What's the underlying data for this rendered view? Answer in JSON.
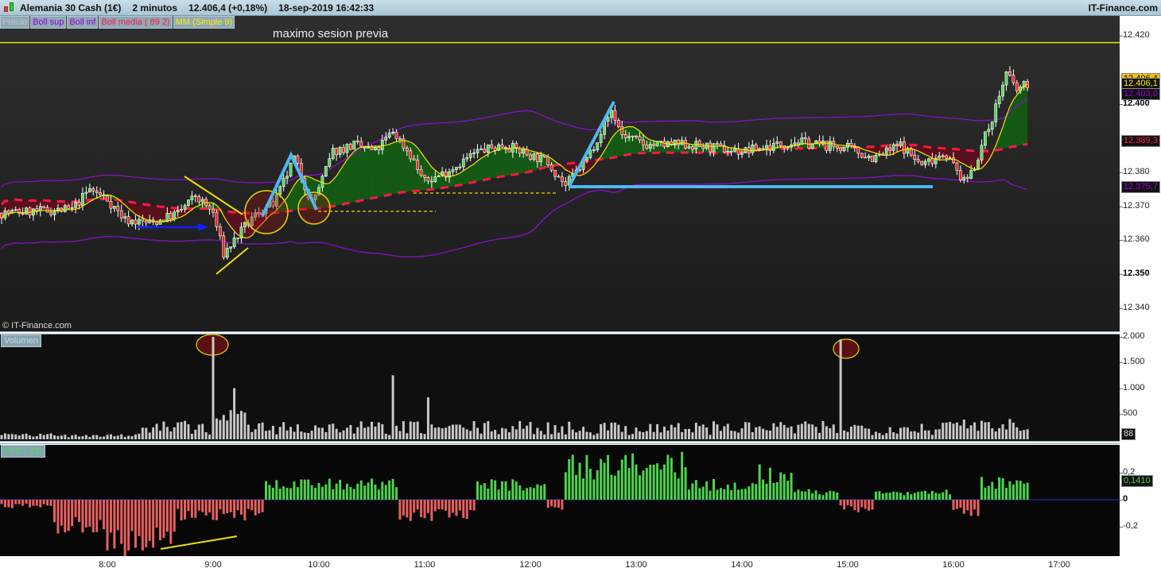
{
  "titlebar": {
    "instrument": "Alemania 30 Cash (1€)",
    "timeframe": "2 minutos",
    "last": "12.406,4 (+0,18%)",
    "datetime": "18-sep-2019 16:42:33",
    "brand": "IT-Finance.com"
  },
  "legend": [
    {
      "label": "Precio",
      "color": "#b8c6cc"
    },
    {
      "label": "Boll sup",
      "color": "#9a00d8"
    },
    {
      "label": "Boll inf",
      "color": "#9a00d8"
    },
    {
      "label": "Boll media ( 89 2)",
      "color": "#ff1a40"
    },
    {
      "label": "MM (Simple 9)",
      "color": "#ffee00"
    }
  ],
  "annotation": "maximo sesion previa",
  "copyright": "© IT-Finance.com",
  "price_axis": {
    "ticks": [
      {
        "label": "12.420",
        "v": 12420
      },
      {
        "label": "12.400",
        "v": 12400,
        "bold": true
      },
      {
        "label": "12.380",
        "v": 12380
      },
      {
        "label": "12.370",
        "v": 12370
      },
      {
        "label": "12.360",
        "v": 12360
      },
      {
        "label": "12.350",
        "v": 12350,
        "bold": true
      },
      {
        "label": "12.340",
        "v": 12340
      }
    ],
    "badges": [
      {
        "label": "12.406,4",
        "v": 12407.4,
        "color": "#000",
        "bg": "#f5c000"
      },
      {
        "label": "12.406,1",
        "v": 12406.1,
        "color": "#ffee00",
        "bg": "#111"
      },
      {
        "label": "12.403,0",
        "v": 12403.0,
        "color": "#9a00d8",
        "bg": "#111"
      },
      {
        "label": "12.389,3",
        "v": 12389.3,
        "color": "#ff1a40",
        "bg": "#111"
      },
      {
        "label": "12.375,7",
        "v": 12375.7,
        "color": "#9a00d8",
        "bg": "#111"
      }
    ]
  },
  "volume": {
    "tag": "Volumen",
    "ticks": [
      {
        "label": "2.000",
        "v": 2000
      },
      {
        "label": "1.500",
        "v": 1500
      },
      {
        "label": "1.000",
        "v": 1000
      },
      {
        "label": "500",
        "v": 500
      }
    ],
    "last": "88"
  },
  "cfd": {
    "tag": "CFD ( 21)",
    "ticks": [
      {
        "label": "0,2",
        "v": 0.2
      },
      {
        "label": "0",
        "v": 0,
        "bold": true
      },
      {
        "label": "-0,2",
        "v": -0.2
      }
    ],
    "last": "0,1410",
    "last_value": 0.141
  },
  "time_axis": [
    "8:00",
    "9:00",
    "10:00",
    "11:00",
    "12:00",
    "13:00",
    "14:00",
    "15:00",
    "16:00",
    "17:00"
  ],
  "chart_data": {
    "type": "candlestick",
    "interval_minutes": 2,
    "start": "7:00",
    "end": "16:42",
    "session_high_prior": 12418,
    "price_path": [
      [
        "7:00",
        12368
      ],
      [
        "7:40",
        12369
      ],
      [
        "7:50",
        12375
      ],
      [
        "8:00",
        12372
      ],
      [
        "8:10",
        12366
      ],
      [
        "8:25",
        12365
      ],
      [
        "8:40",
        12368
      ],
      [
        "8:50",
        12373
      ],
      [
        "9:00",
        12368
      ],
      [
        "9:06",
        12356
      ],
      [
        "9:15",
        12362
      ],
      [
        "9:25",
        12368
      ],
      [
        "9:35",
        12371
      ],
      [
        "9:46",
        12384
      ],
      [
        "9:56",
        12371
      ],
      [
        "10:02",
        12378
      ],
      [
        "10:08",
        12386
      ],
      [
        "10:20",
        12388
      ],
      [
        "10:32",
        12386
      ],
      [
        "10:42",
        12392
      ],
      [
        "10:52",
        12385
      ],
      [
        "11:00",
        12377
      ],
      [
        "11:12",
        12380
      ],
      [
        "11:30",
        12386
      ],
      [
        "11:45",
        12388
      ],
      [
        "12:00",
        12385
      ],
      [
        "12:10",
        12383
      ],
      [
        "12:20",
        12376
      ],
      [
        "12:32",
        12384
      ],
      [
        "12:46",
        12398
      ],
      [
        "12:52",
        12391
      ],
      [
        "13:05",
        12388
      ],
      [
        "13:30",
        12388
      ],
      [
        "14:00",
        12386
      ],
      [
        "14:30",
        12389
      ],
      [
        "15:00",
        12387
      ],
      [
        "15:15",
        12384
      ],
      [
        "15:30",
        12388
      ],
      [
        "15:42",
        12382
      ],
      [
        "15:55",
        12386
      ],
      [
        "16:06",
        12377
      ],
      [
        "16:12",
        12382
      ],
      [
        "16:22",
        12396
      ],
      [
        "16:30",
        12409
      ],
      [
        "16:36",
        12404
      ],
      [
        "16:42",
        12406
      ]
    ],
    "volume_spikes": [
      [
        "9:00",
        2000
      ],
      [
        "10:42",
        1250
      ],
      [
        "14:56",
        1950
      ],
      [
        "11:02",
        820
      ],
      [
        "9:12",
        1000
      ]
    ],
    "cfd_segments": [
      [
        "7:00",
        "7:30",
        -0.05
      ],
      [
        "7:30",
        "8:00",
        -0.22
      ],
      [
        "8:00",
        "8:40",
        -0.34
      ],
      [
        "8:40",
        "9:30",
        -0.12
      ],
      [
        "9:30",
        "10:46",
        0.12
      ],
      [
        "10:46",
        "11:30",
        -0.12
      ],
      [
        "11:30",
        "12:10",
        0.12
      ],
      [
        "12:10",
        "12:20",
        -0.06
      ],
      [
        "12:20",
        "13:30",
        0.27
      ],
      [
        "13:30",
        "14:10",
        0.12
      ],
      [
        "14:10",
        "14:30",
        0.2
      ],
      [
        "14:30",
        "14:56",
        0.06
      ],
      [
        "14:56",
        "15:15",
        -0.07
      ],
      [
        "15:15",
        "15:60",
        0.06
      ],
      [
        "16:00",
        "16:16",
        -0.1
      ],
      [
        "16:16",
        "16:44",
        0.13
      ]
    ]
  }
}
